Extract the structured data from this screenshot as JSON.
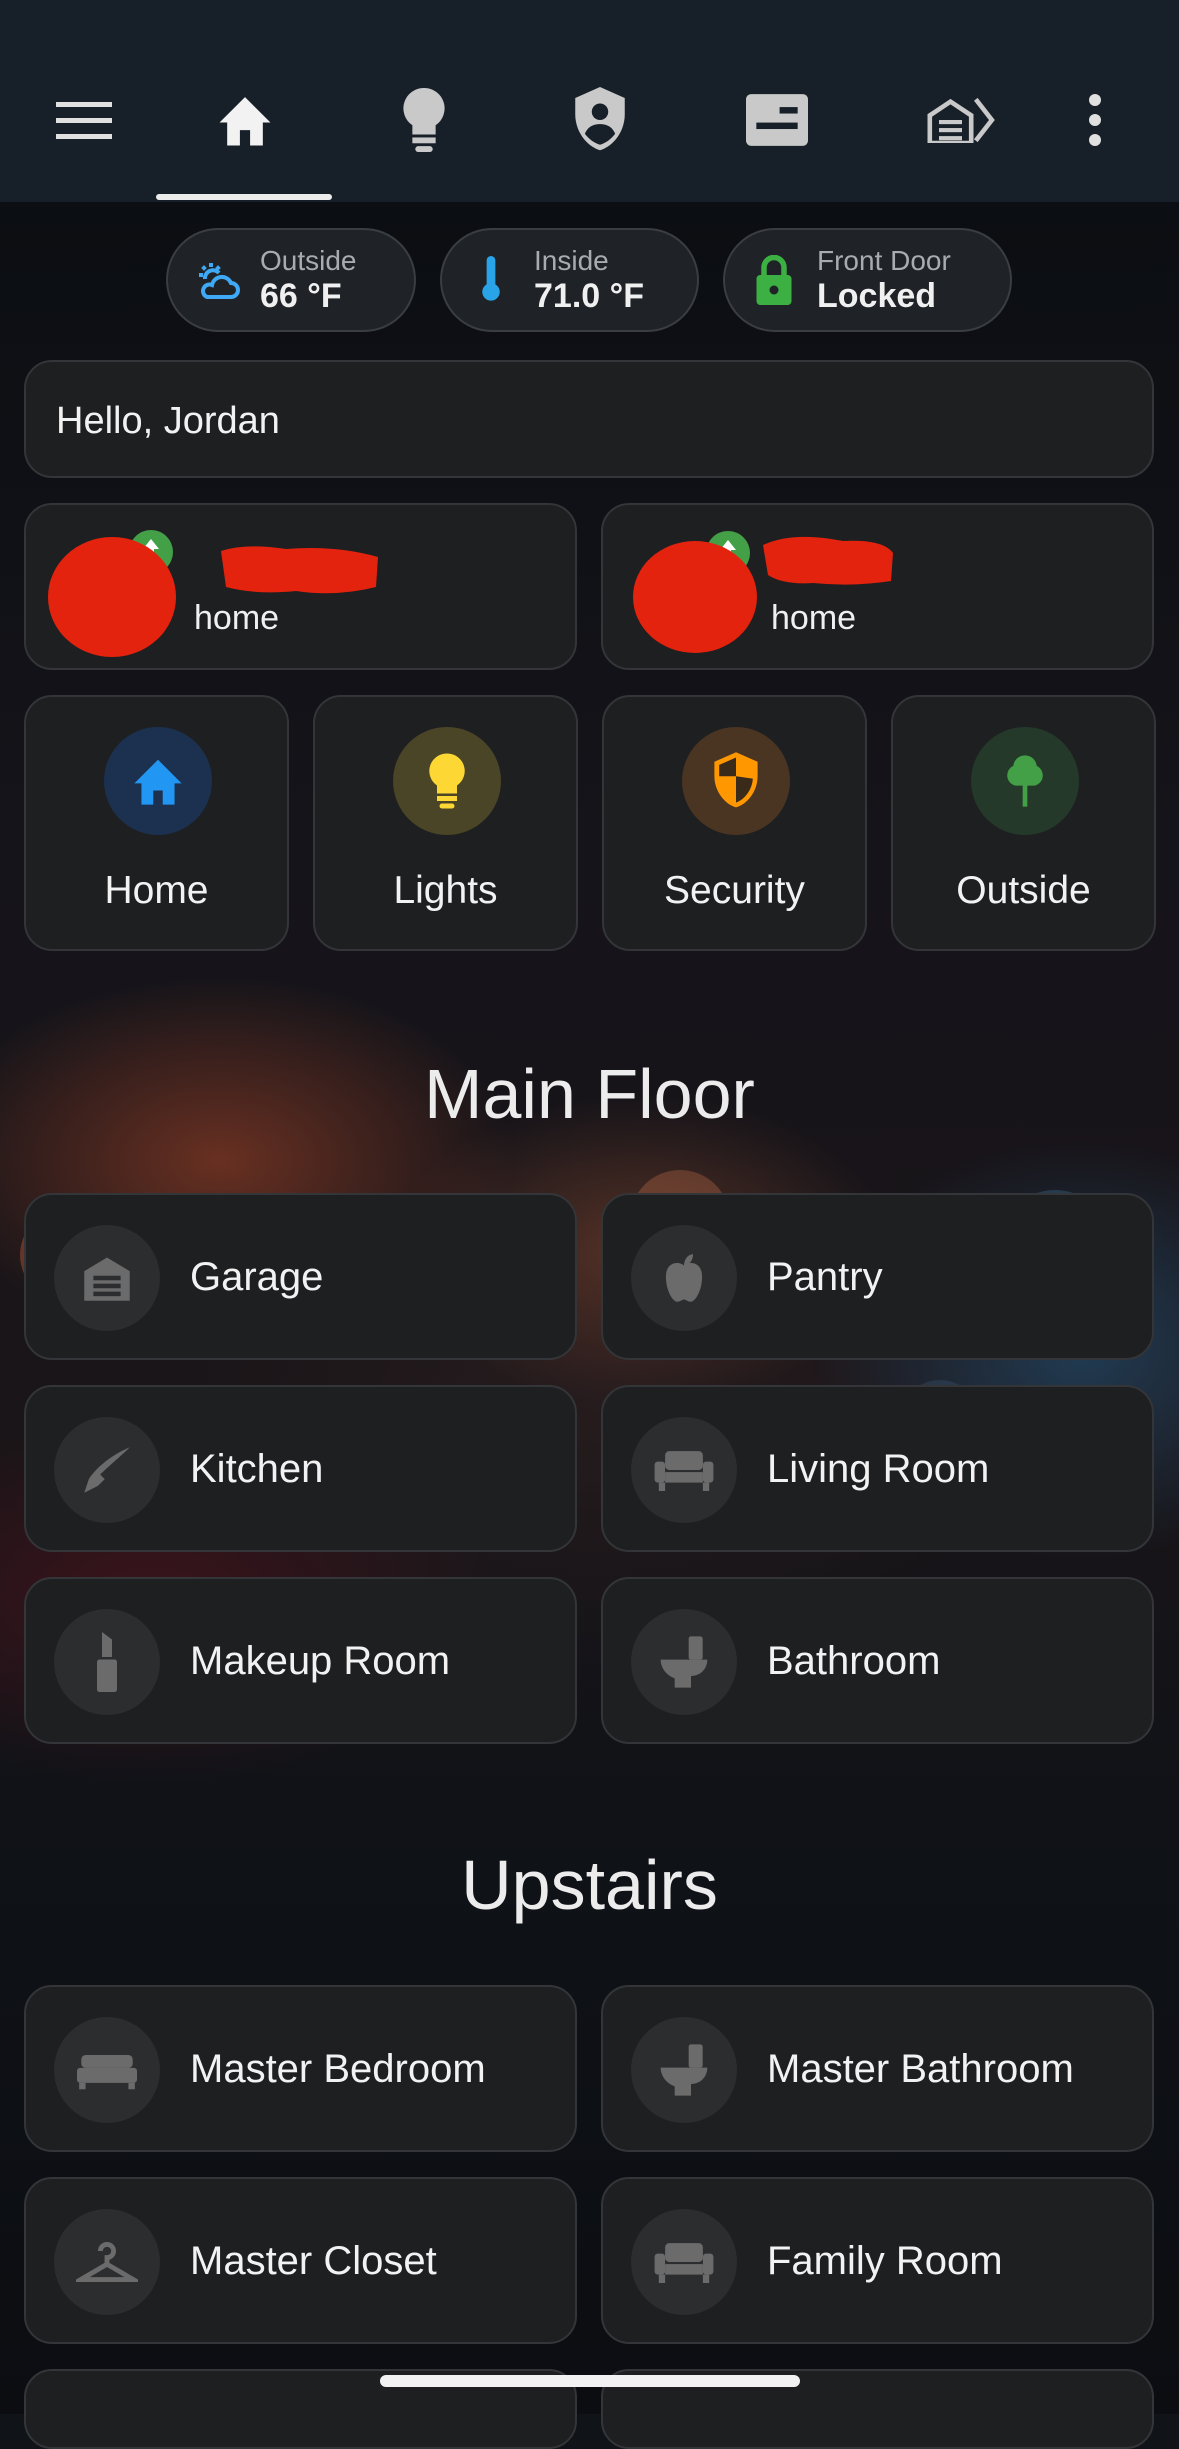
{
  "top_nav": {
    "items": [
      {
        "icon": "menu-icon"
      },
      {
        "icon": "home-icon",
        "active": true
      },
      {
        "icon": "lightbulb-icon"
      },
      {
        "icon": "shield-account-icon"
      },
      {
        "icon": "card-icon"
      },
      {
        "icon": "garage-arrow-icon"
      },
      {
        "icon": "more-vertical-icon"
      }
    ]
  },
  "status_chips": {
    "outside": {
      "label": "Outside",
      "value": "66 °F",
      "icon": "weather-partly-cloudy-icon",
      "color": "#3fa9f5"
    },
    "inside": {
      "label": "Inside",
      "value": "71.0 °F",
      "icon": "thermometer-icon",
      "color": "#2aa4e8"
    },
    "front_door": {
      "label": "Front Door",
      "value": "Locked",
      "icon": "lock-icon",
      "color": "#3cb043"
    }
  },
  "greeting": "Hello, Jordan",
  "people": [
    {
      "state": "home",
      "redacted": true
    },
    {
      "state": "home",
      "redacted": true
    }
  ],
  "nav_cards": [
    {
      "label": "Home",
      "icon": "home-icon",
      "color": "#2196f3",
      "bg": "#1c3150"
    },
    {
      "label": "Lights",
      "icon": "lightbulb-icon",
      "color": "#fdd835",
      "bg": "#4a4526"
    },
    {
      "label": "Security",
      "icon": "shield-half-icon",
      "color": "#ff9800",
      "bg": "#4a3422"
    },
    {
      "label": "Outside",
      "icon": "tree-icon",
      "color": "#43a047",
      "bg": "#24392a"
    }
  ],
  "sections": {
    "main_floor": {
      "title": "Main Floor",
      "rooms": [
        {
          "label": "Garage",
          "icon": "garage-icon"
        },
        {
          "label": "Pantry",
          "icon": "apple-icon"
        },
        {
          "label": "Kitchen",
          "icon": "knife-icon"
        },
        {
          "label": "Living Room",
          "icon": "sofa-icon"
        },
        {
          "label": "Makeup Room",
          "icon": "lipstick-icon"
        },
        {
          "label": "Bathroom",
          "icon": "toilet-icon"
        }
      ]
    },
    "upstairs": {
      "title": "Upstairs",
      "rooms": [
        {
          "label": "Master Bedroom",
          "icon": "bed-icon"
        },
        {
          "label": "Master Bathroom",
          "icon": "toilet-icon"
        },
        {
          "label": "Master Closet",
          "icon": "hanger-icon"
        },
        {
          "label": "Family Room",
          "icon": "sofa-icon"
        }
      ]
    }
  }
}
